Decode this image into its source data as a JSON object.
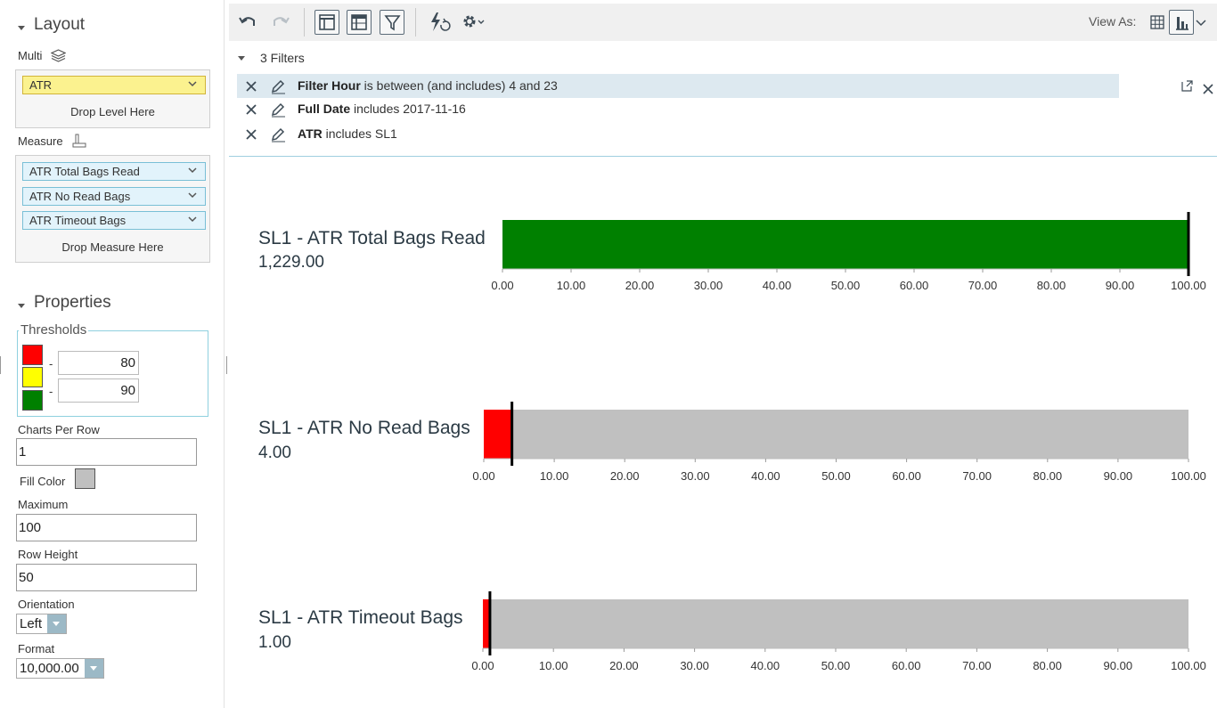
{
  "layout_section": {
    "title": "Layout",
    "multi_label": "Multi",
    "level_pill": "ATR",
    "drop_level_text": "Drop Level Here",
    "measure_label": "Measure",
    "measures": [
      "ATR Total Bags Read",
      "ATR No Read Bags",
      "ATR Timeout Bags"
    ],
    "drop_measure_text": "Drop Measure Here"
  },
  "properties_section": {
    "title": "Properties",
    "thresholds_label": "Thresholds",
    "threshold_dash": "-",
    "threshold_low": "80",
    "threshold_high": "90",
    "threshold_colors": {
      "low": "#ff0000",
      "mid": "#ffff00",
      "high": "#008000"
    },
    "charts_per_row_label": "Charts Per Row",
    "charts_per_row": "1",
    "fill_color_label": "Fill Color",
    "fill_color": "#c0c0c0",
    "maximum_label": "Maximum",
    "maximum": "100",
    "row_height_label": "Row Height",
    "row_height": "50",
    "orientation_label": "Orientation",
    "orientation": "Left",
    "format_label": "Format",
    "format": "10,000.00"
  },
  "toolbar": {
    "icons": [
      "undo-icon",
      "redo-icon",
      "layout-panel-icon",
      "table-layout-icon",
      "filter-icon",
      "auto-refresh-icon",
      "settings-icon"
    ],
    "view_as_label": "View As:",
    "view_icons": [
      "grid-view-icon",
      "chart-view-icon"
    ]
  },
  "filters": {
    "header": "3 Filters",
    "items": [
      {
        "field": "Filter Hour",
        "condition": " is between (and includes) 4 and 23"
      },
      {
        "field": "Full Date",
        "condition": " includes 2017-11-16"
      },
      {
        "field": "ATR",
        "condition": " includes SL1"
      }
    ]
  },
  "colors": {
    "accent": "#79bfd6",
    "green": "#008000",
    "red": "#ff0000",
    "track": "#c0c0c0"
  },
  "chart_data": [
    {
      "type": "bar",
      "title": "SL1 - ATR Total Bags Read",
      "value_label": "1,229.00",
      "value": 1229,
      "target": 100,
      "xlim": [
        0,
        100
      ],
      "ticks": [
        "0.00",
        "10.00",
        "20.00",
        "30.00",
        "40.00",
        "50.00",
        "60.00",
        "70.00",
        "80.00",
        "90.00",
        "100.00"
      ],
      "bar_color": "#008000"
    },
    {
      "type": "bar",
      "title": "SL1 - ATR No Read Bags",
      "value_label": "4.00",
      "value": 4,
      "target": 4,
      "xlim": [
        0,
        100
      ],
      "ticks": [
        "0.00",
        "10.00",
        "20.00",
        "30.00",
        "40.00",
        "50.00",
        "60.00",
        "70.00",
        "80.00",
        "90.00",
        "100.00"
      ],
      "bar_color": "#ff0000"
    },
    {
      "type": "bar",
      "title": "SL1 - ATR Timeout Bags",
      "value_label": "1.00",
      "value": 1,
      "target": 1,
      "xlim": [
        0,
        100
      ],
      "ticks": [
        "0.00",
        "10.00",
        "20.00",
        "30.00",
        "40.00",
        "50.00",
        "60.00",
        "70.00",
        "80.00",
        "90.00",
        "100.00"
      ],
      "bar_color": "#ff0000"
    }
  ]
}
